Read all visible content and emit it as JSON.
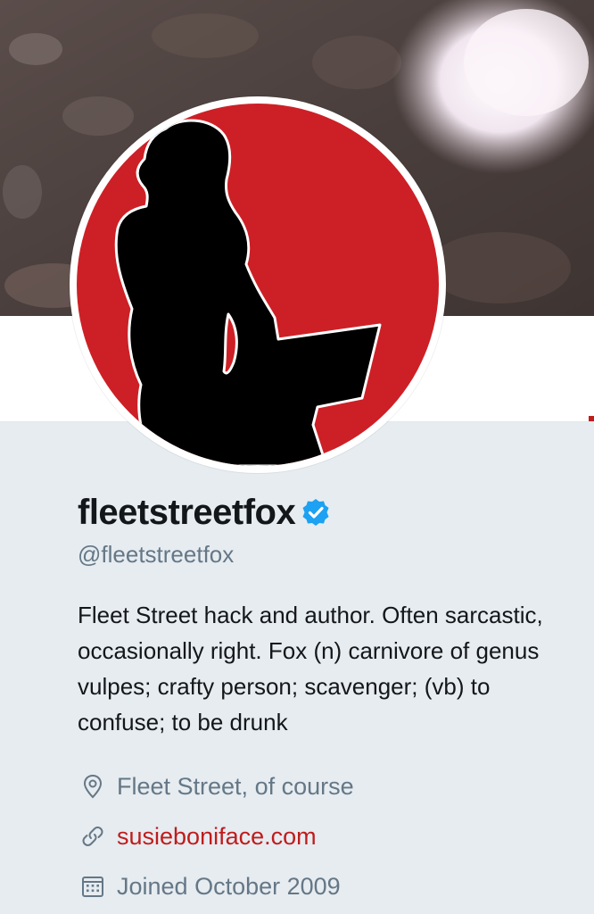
{
  "profile": {
    "display_name": "fleetstreetfox",
    "handle": "@fleetstreetfox",
    "verified_icon": "verified-badge-icon",
    "bio": "Fleet Street hack and author. Often sarcastic, occasionally right. Fox (n) carnivore of genus vulpes; crafty person; scavenger; (vb) to confuse; to be drunk",
    "location": "Fleet Street, of course",
    "website": "susieboniface.com",
    "joined": "Joined October 2009"
  },
  "colors": {
    "accent": "#c01c1c",
    "avatar_red": "#cc2026",
    "verified_blue": "#1da1f2",
    "text_secondary": "#657786",
    "background": "#e6ecf0"
  },
  "icons": {
    "location": "location-pin-icon",
    "link": "link-icon",
    "calendar": "calendar-icon"
  }
}
